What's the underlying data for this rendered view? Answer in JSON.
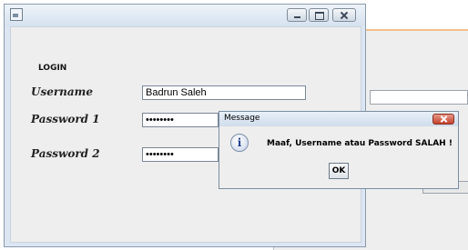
{
  "login_window": {
    "heading": "LOGIN",
    "username_label": "Username",
    "username_value": "Badrun Saleh",
    "password1_label": "Password 1",
    "password1_value": "••••••••",
    "password2_label": "Password 2",
    "password2_value": "••••••••"
  },
  "message_dialog": {
    "title": "Message",
    "text": "Maaf, Username atau Password SALAH !",
    "ok_label": "OK",
    "icon": "info-icon"
  },
  "colors": {
    "title_gradient_top": "#eef3f9",
    "dialog_close": "#c2412c"
  }
}
